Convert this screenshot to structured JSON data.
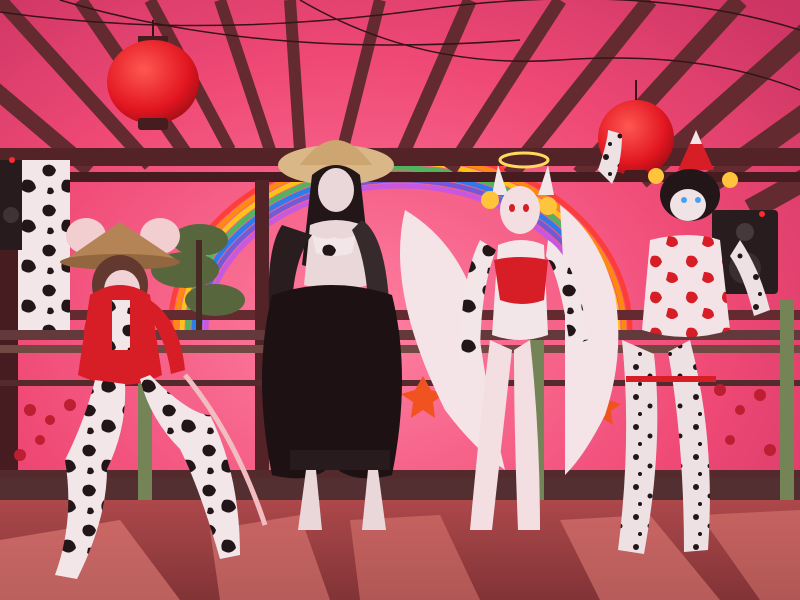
{
  "scene": {
    "description_visible_text": "",
    "colors": {
      "sky": "#ef4b77",
      "sky_glow": "#ff7ea0",
      "wood": "#5a2b2c",
      "wood_dark": "#3c1b1d",
      "lantern": "#e0141c",
      "floor": "#c24a4a",
      "floor_light": "#e98a7f",
      "bamboo": "#6c8a55",
      "cow_white": "#f2f2f2",
      "cow_black": "#151515",
      "red_outfit": "#d51c22",
      "black_outfit": "#101010",
      "halo": "#ffe45c",
      "rainbow": [
        "#ff3b30",
        "#ff9500",
        "#ffd60a",
        "#34c759",
        "#0a84ff",
        "#5e5ce6",
        "#bf5af2"
      ]
    },
    "figures": [
      {
        "name": "cow-figure-hat"
      },
      {
        "name": "black-outfit-figure"
      },
      {
        "name": "winged-cow-figure"
      },
      {
        "name": "red-spotted-figure"
      }
    ]
  }
}
